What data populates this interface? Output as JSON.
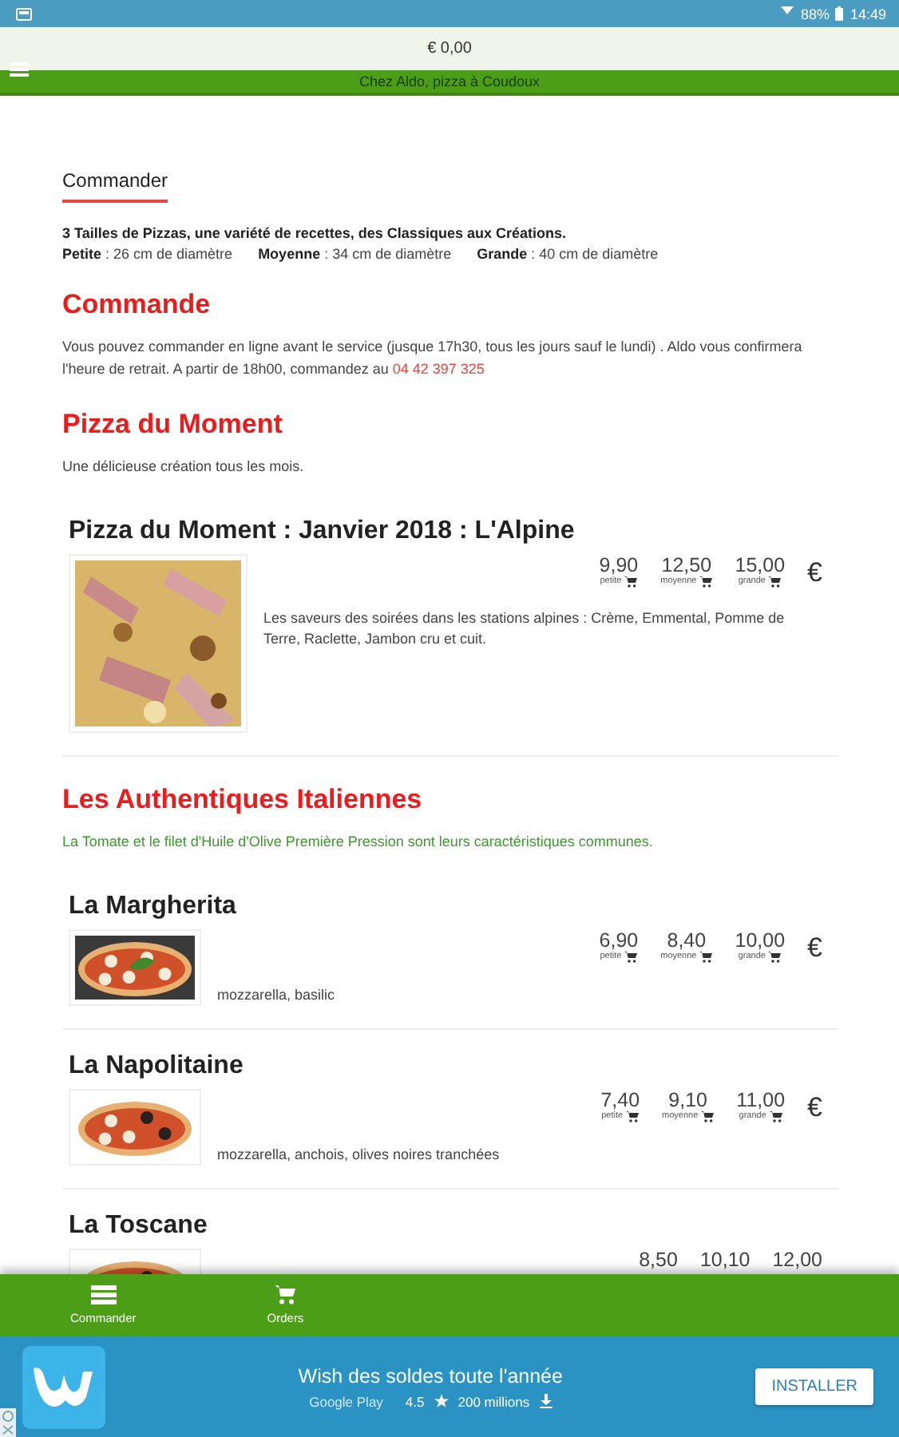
{
  "status_bar": {
    "battery": "88%",
    "time": "14:49"
  },
  "cart_bar": {
    "total": "€ 0,00"
  },
  "app_bar": {
    "title": "Chez Aldo, pizza à Coudoux"
  },
  "tabs": [
    {
      "label": "Commander",
      "selected": true
    }
  ],
  "intro": {
    "headline": "3 Tailles de Pizzas, une variété de recettes, des Classiques aux Créations.",
    "sizes": [
      "**Petite** : 26 cm de diamètre",
      "**Moyenne** : 34 cm de diamètre",
      "**Grande** : 40 cm de diamètre"
    ]
  },
  "sections": [
    {
      "title": "Commande",
      "description": {
        "kind": "plain",
        "text": "Vous pouvez commander en ligne avant le service (jusque 17h30, tous les jours sauf le lundi) . Aldo vous confirmera l'heure de retrait. A partir de 18h00, commandez  au",
        "phone": "04 42 397 325"
      }
    },
    {
      "title": "Pizza du Moment",
      "description": {
        "kind": "plain",
        "text": "Une délicieuse création tous les mois."
      },
      "pizzas": [
        {
          "kind": "featured",
          "name": "Pizza du Moment : Janvier 2018 : L'Alpine",
          "description": "Les saveurs des soirées dans les stations alpines : Crème, Emmental, Pomme de Terre, Raclette, Jambon cru et cuit.",
          "currency": "€",
          "prices": [
            {
              "price": "9,90",
              "size": "petite"
            },
            {
              "price": "12,50",
              "size": "moyenne"
            },
            {
              "price": "15,00",
              "size": "grande"
            }
          ]
        }
      ]
    },
    {
      "title": "Les Authentiques Italiennes",
      "description": {
        "kind": "accent",
        "text": "La Tomate et le filet d'Huile d'Olive Première Pression sont leurs caractéristiques communes."
      },
      "pizzas": [
        {
          "kind": "standard",
          "name": "La Margherita",
          "description": "mozzarella, basilic",
          "currency": "€",
          "prices": [
            {
              "price": "6,90",
              "size": "petite"
            },
            {
              "price": "8,40",
              "size": "moyenne"
            },
            {
              "price": "10,00",
              "size": "grande"
            }
          ]
        },
        {
          "kind": "standard",
          "name": "La Napolitaine",
          "description": "mozzarella, anchois, olives noires tranchées",
          "currency": "€",
          "prices": [
            {
              "price": "7,40",
              "size": "petite"
            },
            {
              "price": "9,10",
              "size": "moyenne"
            },
            {
              "price": "11,00",
              "size": "grande"
            }
          ]
        },
        {
          "kind": "standard",
          "name": "La Toscane",
          "prices": [
            {
              "price": "8,50"
            },
            {
              "price": "10,10"
            },
            {
              "price": "12,00"
            }
          ]
        }
      ]
    }
  ],
  "bottom_nav": [
    {
      "label": "Commander"
    },
    {
      "label": "Orders"
    }
  ],
  "ad": {
    "title": "Wish des soldes toute l'année",
    "store": "Google Play",
    "rating": "4.5",
    "installs": "200 millions",
    "button": "INSTALLER"
  }
}
